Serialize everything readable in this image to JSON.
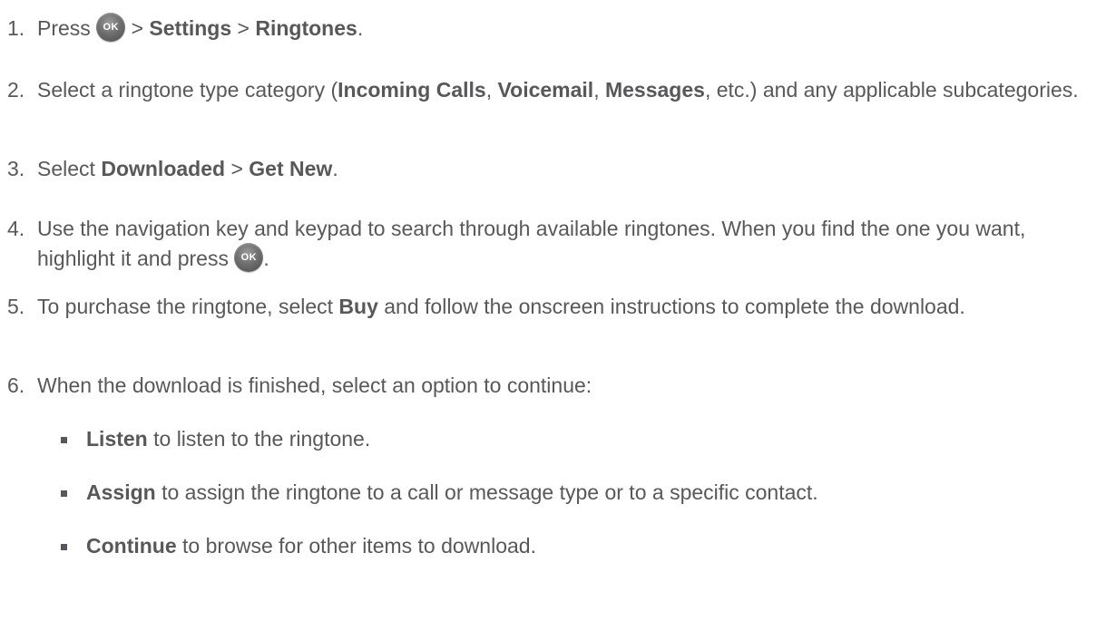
{
  "icons": {
    "ok_button": "ok-button-icon",
    "ok_label": "OK"
  },
  "steps": [
    {
      "number": "1.",
      "p1": "Press ",
      "p2": " > ",
      "b1": "Settings",
      "p3": " > ",
      "b2": "Ringtones",
      "p4": "."
    },
    {
      "number": "2.",
      "p1": "Select a ringtone type category (",
      "b1": "Incoming Calls",
      "p2": ", ",
      "b2": "Voicemail",
      "p3": ", ",
      "b3": "Messages",
      "p4": ", etc.) and any applicable subcategories."
    },
    {
      "number": "3.",
      "p1": "Select ",
      "b1": "Downloaded",
      "p2": " > ",
      "b2": "Get New",
      "p3": "."
    },
    {
      "number": "4.",
      "p1": "Use the navigation key and keypad to search through available ringtones. When you find the one you want, highlight it and press ",
      "p2": "."
    },
    {
      "number": "5.",
      "p1": "To purchase the ringtone, select ",
      "b1": "Buy",
      "p2": " and follow the onscreen instructions to complete the download."
    },
    {
      "number": "6.",
      "p1": "When the download is finished, select an option to continue:"
    }
  ],
  "options": [
    {
      "bold": "Listen",
      "rest": " to listen to the ringtone."
    },
    {
      "bold": "Assign",
      "rest": " to assign the ringtone to a call or message type or to a specific contact."
    },
    {
      "bold": "Continue",
      "rest": " to browse for other items to download."
    }
  ]
}
